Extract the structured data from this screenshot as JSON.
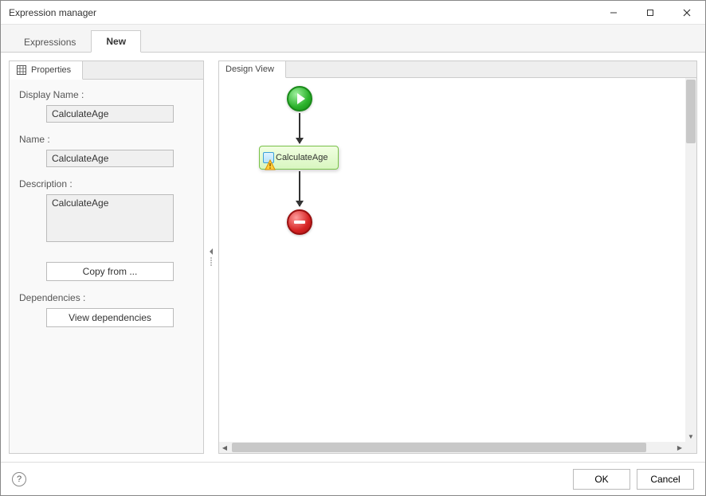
{
  "window": {
    "title": "Expression manager"
  },
  "top_tabs": {
    "expressions": "Expressions",
    "new": "New"
  },
  "left_panel": {
    "tab_label": "Properties",
    "display_name_label": "Display Name :",
    "display_name_value": "CalculateAge",
    "name_label": "Name :",
    "name_value": "CalculateAge",
    "description_label": "Description :",
    "description_value": "CalculateAge",
    "copy_from_label": "Copy from ...",
    "dependencies_label": "Dependencies :",
    "view_dependencies_label": "View dependencies"
  },
  "right_panel": {
    "tab_label": "Design View",
    "node_label": "CalculateAge"
  },
  "footer": {
    "ok_label": "OK",
    "cancel_label": "Cancel"
  }
}
